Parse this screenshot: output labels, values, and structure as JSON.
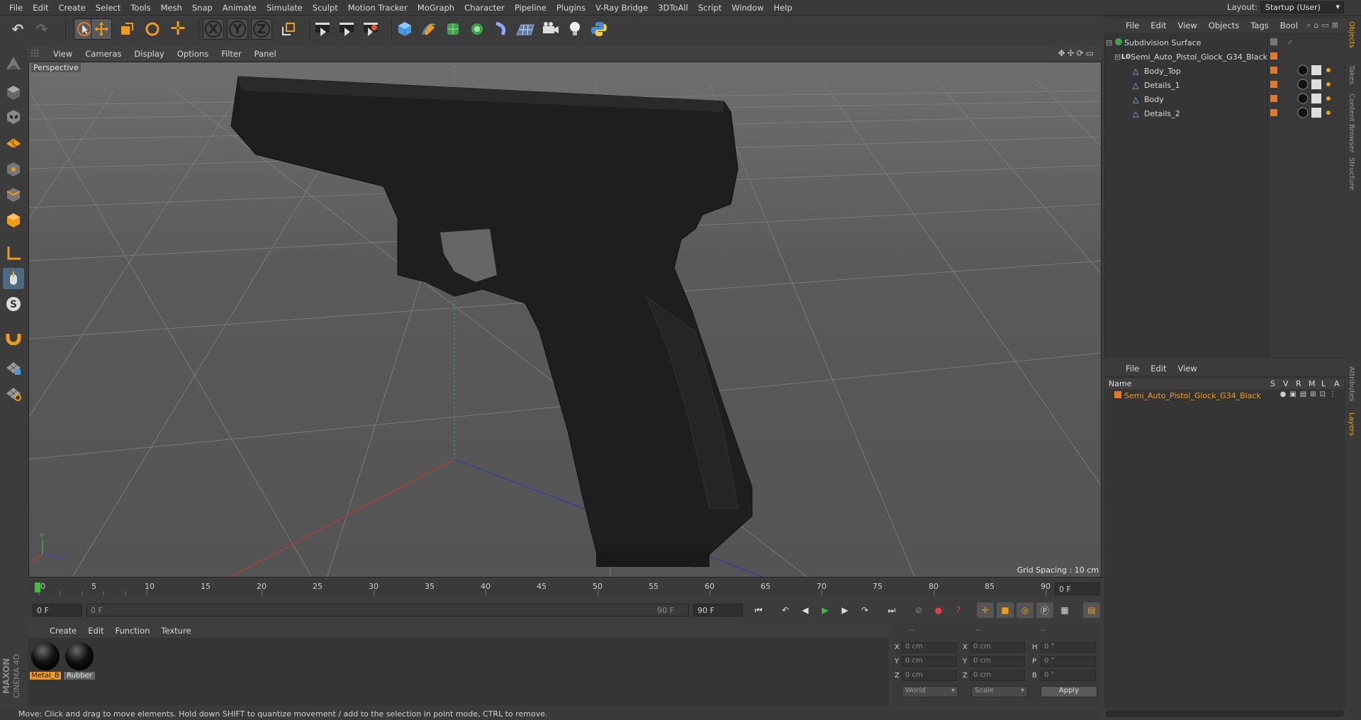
{
  "menubar": {
    "items": [
      "File",
      "Edit",
      "Create",
      "Select",
      "Tools",
      "Mesh",
      "Snap",
      "Animate",
      "Simulate",
      "Sculpt",
      "Motion Tracker",
      "MoGraph",
      "Character",
      "Pipeline",
      "Plugins",
      "V-Ray Bridge",
      "3DToAll",
      "Script",
      "Window",
      "Help"
    ],
    "layout_label": "Layout:",
    "layout_value": "Startup (User)"
  },
  "viewport": {
    "menu": [
      "View",
      "Cameras",
      "Display",
      "Options",
      "Filter",
      "Panel"
    ],
    "label": "Perspective",
    "grid_spacing": "Grid Spacing : 10 cm"
  },
  "timeline": {
    "ticks": [
      "0",
      "5",
      "10",
      "15",
      "20",
      "25",
      "30",
      "35",
      "40",
      "45",
      "50",
      "55",
      "60",
      "65",
      "70",
      "75",
      "80",
      "85",
      "90"
    ],
    "current_frame": "0 F",
    "start_frame": "0 F",
    "range_start": "0 F",
    "range_end": "90 F",
    "end_frame": "90 F"
  },
  "materials": {
    "menu": [
      "Create",
      "Edit",
      "Function",
      "Texture"
    ],
    "items": [
      {
        "name": "Metal_B",
        "selected": true
      },
      {
        "name": "Rubber",
        "selected": false
      }
    ]
  },
  "coords": {
    "header": [
      "--",
      "--",
      "--"
    ],
    "rows": [
      {
        "a": "X",
        "av": "0 cm",
        "b": "X",
        "bv": "0 cm",
        "c": "H",
        "cv": "0 °"
      },
      {
        "a": "Y",
        "av": "0 cm",
        "b": "Y",
        "bv": "0 cm",
        "c": "P",
        "cv": "0 °"
      },
      {
        "a": "Z",
        "av": "0 cm",
        "b": "Z",
        "bv": "0 cm",
        "c": "B",
        "cv": "0 °"
      }
    ],
    "space": "World",
    "mode": "Scale",
    "apply": "Apply"
  },
  "status": "Move: Click and drag to move elements. Hold down SHIFT to quantize movement / add to the selection in point mode, CTRL to remove.",
  "objects": {
    "menu": [
      "File",
      "Edit",
      "View",
      "Objects",
      "Tags",
      "Bool"
    ],
    "tree": [
      {
        "name": "Subdivision Surface",
        "level": 0
      },
      {
        "name": "Semi_Auto_Pistol_Glock_G34_Black",
        "level": 1
      },
      {
        "name": "Body_Top",
        "level": 2
      },
      {
        "name": "Details_1",
        "level": 2
      },
      {
        "name": "Body",
        "level": 2
      },
      {
        "name": "Details_2",
        "level": 2
      }
    ]
  },
  "layers": {
    "menu": [
      "File",
      "Edit",
      "View"
    ],
    "columns": [
      "Name",
      "S",
      "V",
      "R",
      "M",
      "L",
      "A"
    ],
    "rows": [
      {
        "name": "Semi_Auto_Pistol_Glock_G34_Black"
      }
    ]
  },
  "side_tabs": [
    "Objects",
    "Takes",
    "Content Browser",
    "Structure",
    "Attributes",
    "Layers"
  ],
  "brand": "MAXON CINEMA 4D",
  "colors": {
    "accent": "#f39c12",
    "ui_bg": "#3c3c3c",
    "viewport_bg": "#5e5e5e"
  }
}
